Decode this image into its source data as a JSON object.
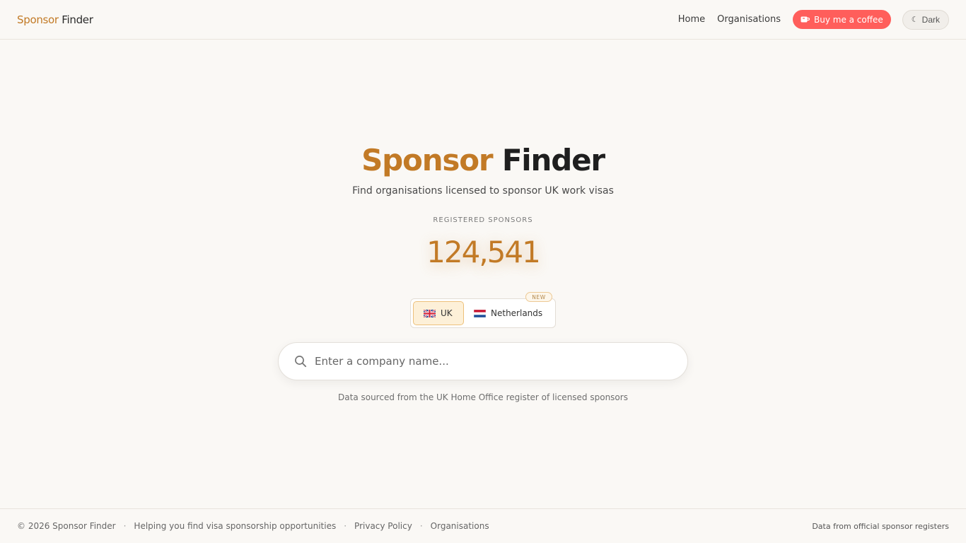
{
  "header": {
    "brand_a": "Sponsor",
    "brand_b": "Finder",
    "nav": {
      "home": "Home",
      "organisations": "Organisations",
      "coffee": "Buy me a coffee",
      "dark": "Dark"
    }
  },
  "hero": {
    "title_a": "Sponsor",
    "title_b": "Finder",
    "subtitle": "Find organisations licensed to sponsor UK work visas",
    "stat_label": "REGISTERED SPONSORS",
    "stat_value": "124,541"
  },
  "country_switch": {
    "options": [
      {
        "label": "UK",
        "active": true
      },
      {
        "label": "Netherlands",
        "active": false
      }
    ],
    "badge": "NEW"
  },
  "search": {
    "placeholder": "Enter a company name...",
    "value": ""
  },
  "source_note": "Data sourced from the UK Home Office register of licensed sponsors",
  "footer": {
    "copyright": "© 2026 Sponsor Finder",
    "tagline": "Helping you find visa sponsorship opportunities",
    "privacy": "Privacy Policy",
    "organisations": "Organisations",
    "separator": "·",
    "right": "Data from official sponsor registers"
  },
  "colors": {
    "accent": "#c27a26",
    "coffee": "#ff5e5b",
    "background": "#faf8f5"
  },
  "icons": {
    "coffee": "coffee-cup-icon",
    "dark": "moon-icon",
    "search": "search-icon",
    "uk": "uk-flag-icon",
    "nl": "netherlands-flag-icon"
  }
}
